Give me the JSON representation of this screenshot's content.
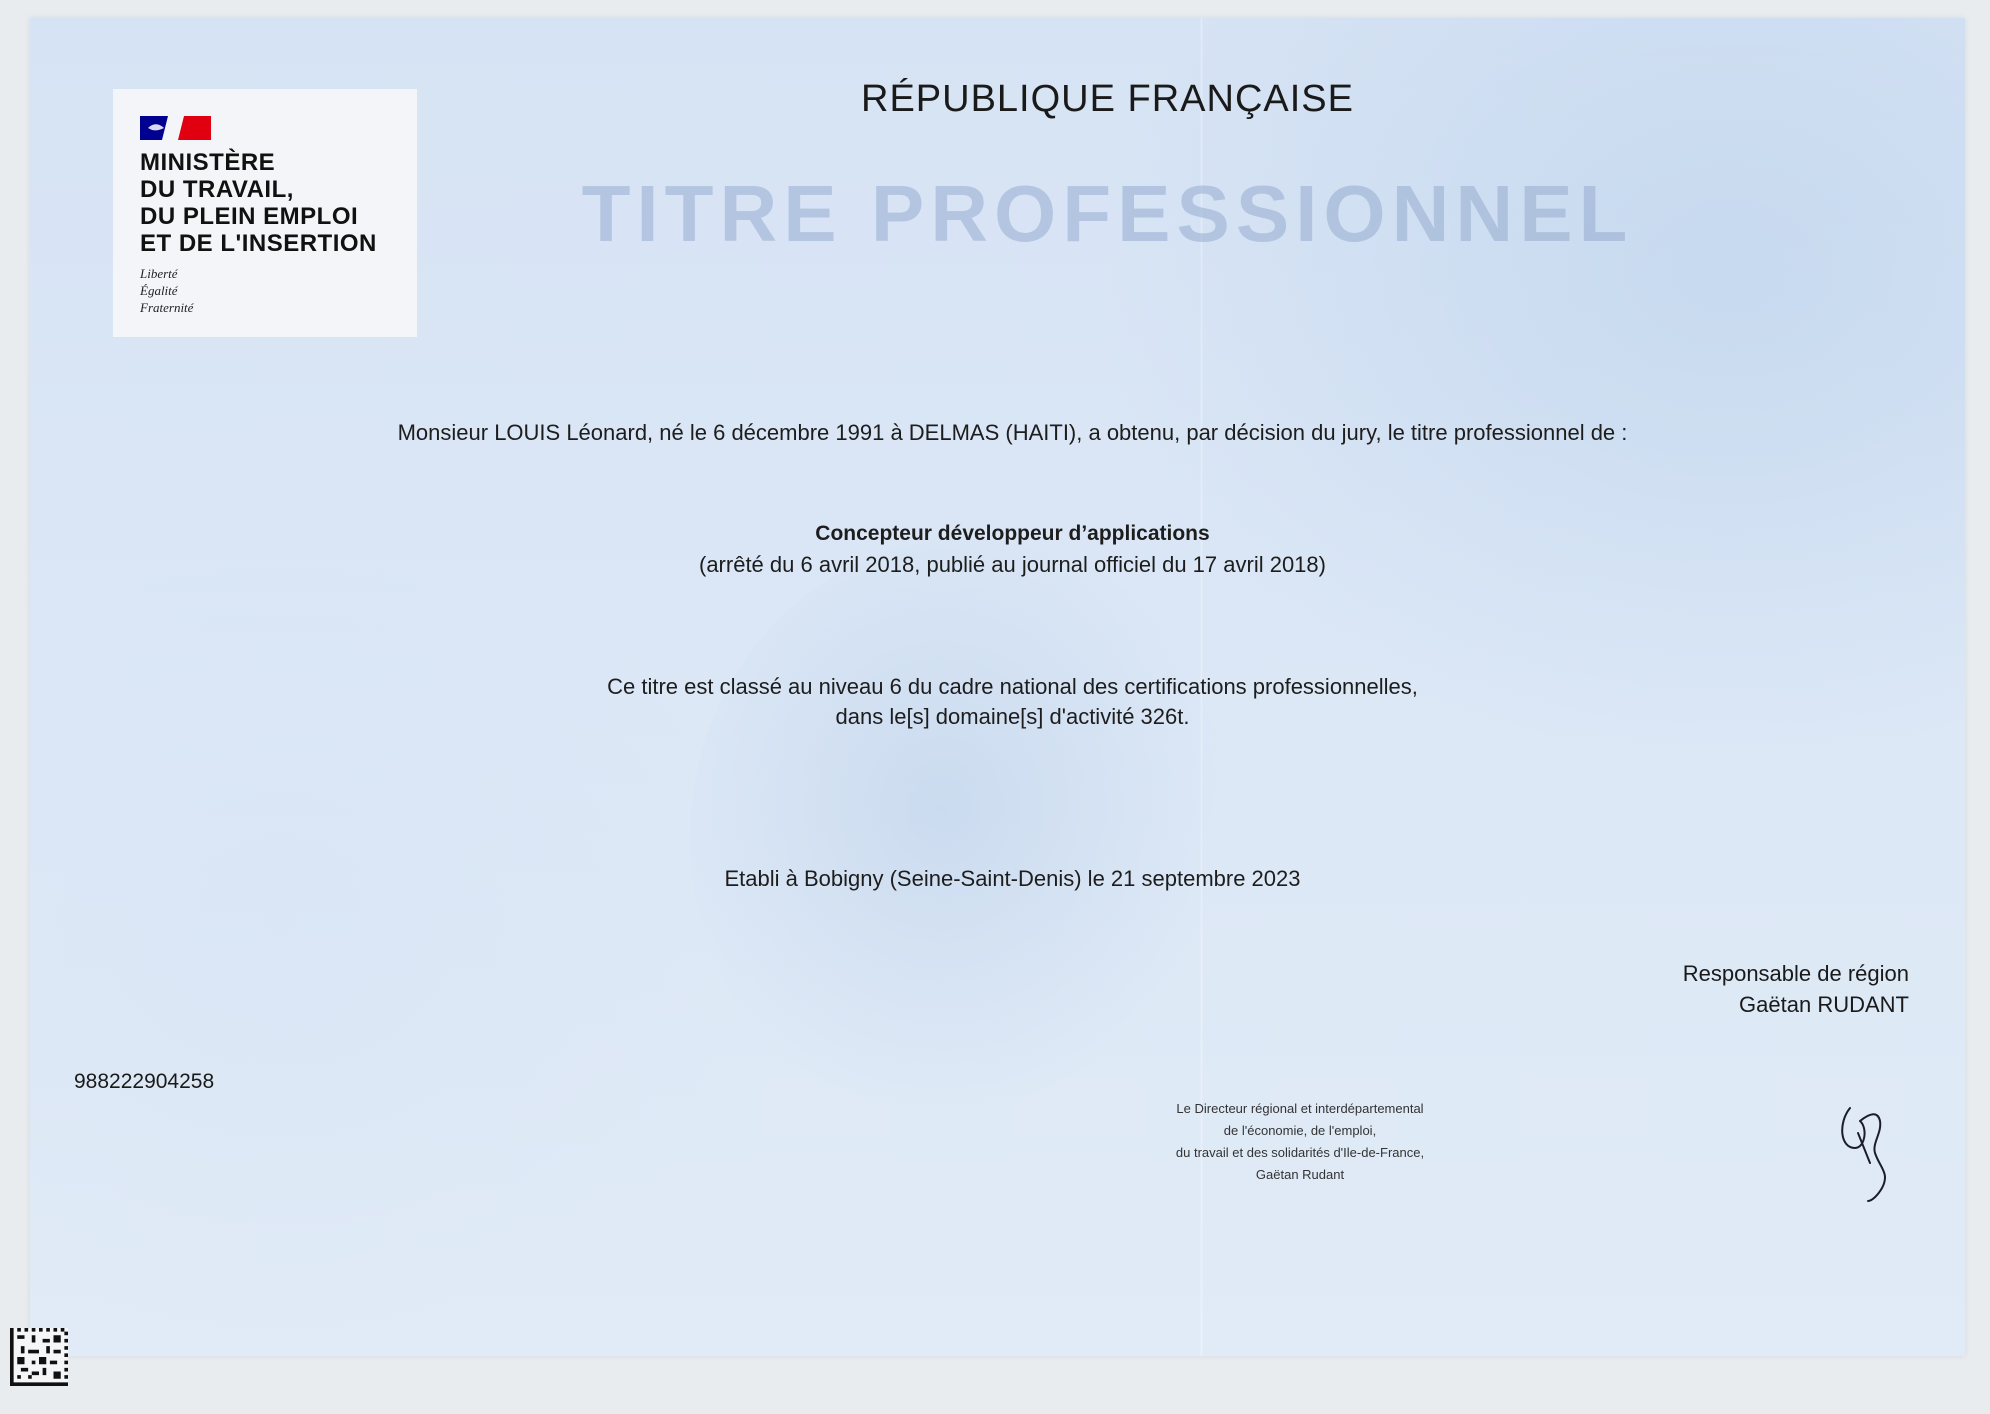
{
  "logo": {
    "ministry_lines": [
      "MINISTÈRE",
      "DU TRAVAIL,",
      "DU PLEIN EMPLOI",
      "ET DE L'INSERTION"
    ],
    "motto": [
      "Liberté",
      "Égalité",
      "Fraternité"
    ],
    "flag_colors": {
      "blue": "#000091",
      "white": "#ffffff",
      "red": "#e1000f"
    }
  },
  "header": {
    "republique": "RÉPUBLIQUE FRANÇAISE",
    "titre": "TITRE PROFESSIONNEL"
  },
  "body": {
    "recipient_line": "Monsieur LOUIS Léonard, né le 6 décembre 1991 à DELMAS (HAITI), a obtenu, par décision du jury, le titre professionnel de :",
    "diploma_title": "Concepteur développeur d’applications",
    "arrete": "(arrêté du 6 avril 2018, publié au journal officiel du 17 avril 2018)",
    "level_line_1": "Ce titre est classé au niveau 6 du cadre national des certifications professionnelles,",
    "level_line_2": "dans le[s] domaine[s] d'activité 326t.",
    "etabli": "Etabli à Bobigny (Seine-Saint-Denis) le 21 septembre 2023"
  },
  "signatory": {
    "role": "Responsable de région",
    "name": "Gaëtan RUDANT"
  },
  "certificate_number": "988222904258",
  "director_block": [
    "Le Directeur régional et interdépartemental",
    "de l'économie, de l'emploi,",
    "du travail et des solidarités d'Ile-de-France,",
    "Gaëtan Rudant"
  ]
}
